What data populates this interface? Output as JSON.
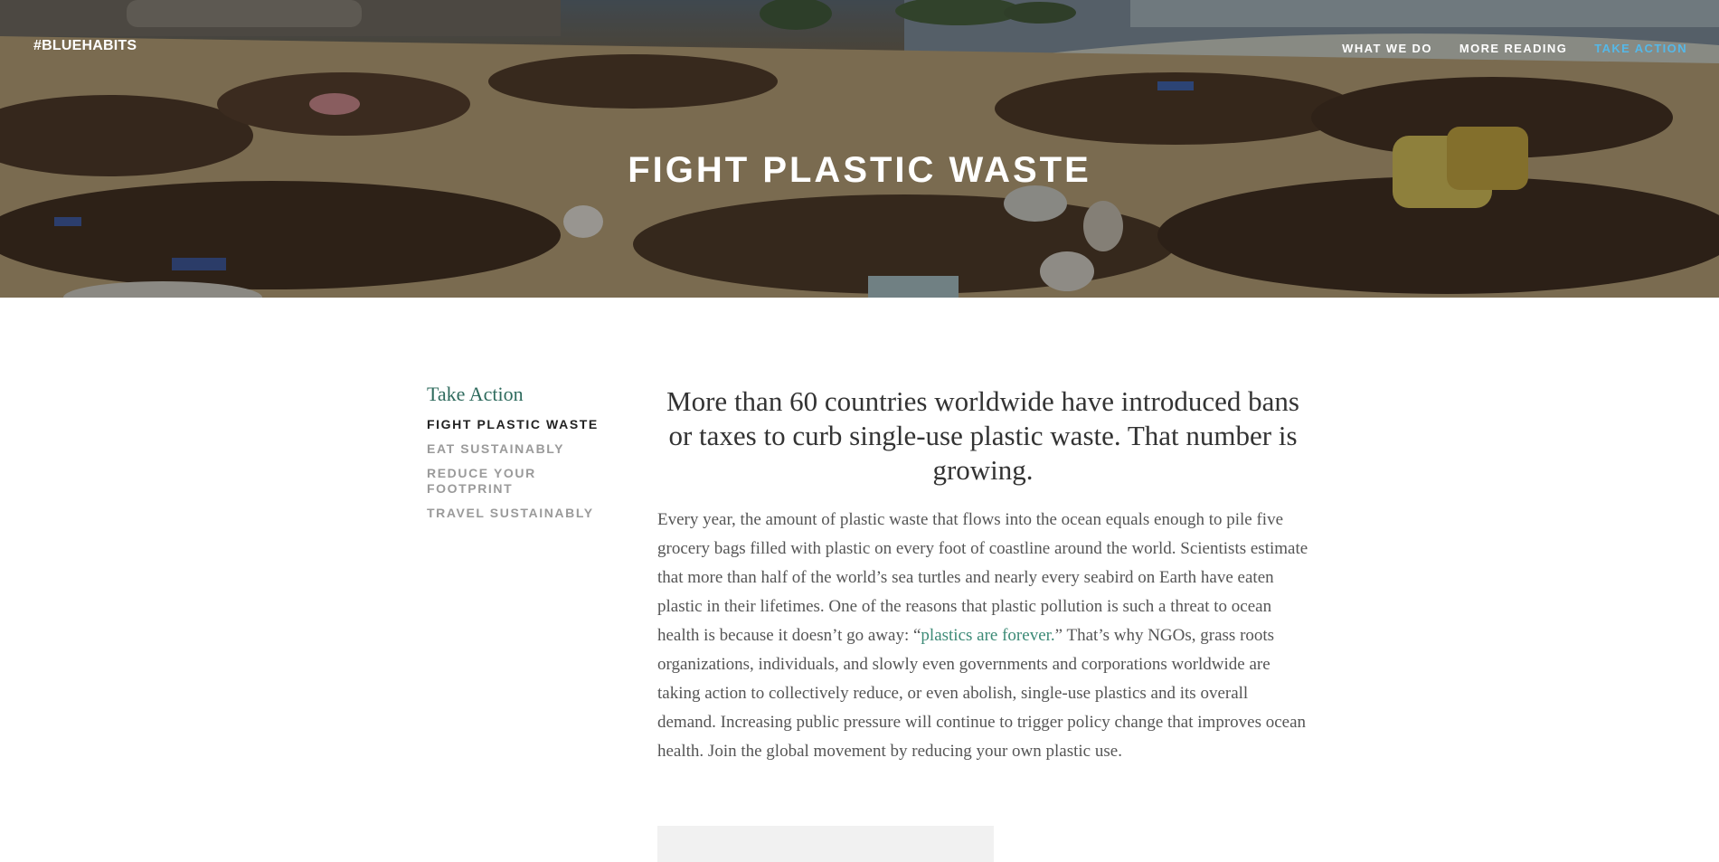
{
  "header": {
    "brand": "#BLUEHABITS",
    "nav": [
      {
        "label": "WHAT WE DO",
        "active": false
      },
      {
        "label": "MORE READING",
        "active": false
      },
      {
        "label": "TAKE ACTION",
        "active": true
      }
    ],
    "hero_title": "FIGHT PLASTIC WASTE"
  },
  "sidebar": {
    "heading": "Take Action",
    "items": [
      {
        "label": "FIGHT PLASTIC WASTE",
        "current": true
      },
      {
        "label": "EAT SUSTAINABLY",
        "current": false
      },
      {
        "label": "REDUCE YOUR FOOTPRINT",
        "current": false
      },
      {
        "label": "TRAVEL SUSTAINABLY",
        "current": false
      }
    ]
  },
  "article": {
    "lead": "More than 60 countries worldwide have introduced bans or taxes to curb single-use plastic waste. That number is growing.",
    "body_before_link": "Every year, the amount of plastic waste that flows into the ocean equals enough to pile five grocery bags filled with plastic on every foot of coastline around the world. Scientists estimate that more than half of the world’s sea turtles and nearly every seabird on Earth have eaten plastic in their lifetimes. One of the reasons that plastic pollution is such a threat to ocean health is because it doesn’t go away: “",
    "link_text": "plastics are forever.",
    "body_after_link": "”  That’s why NGOs, grass roots organizations, individuals, and slowly even governments and corporations worldwide are taking action to collectively reduce, or even abolish, single-use plastics and its overall demand. Increasing public pressure will continue to trigger policy change that improves ocean health. Join the global movement by reducing your own plastic use."
  },
  "colors": {
    "accent_nav": "#55b8e8",
    "link": "#3c8a76",
    "sidebar_heading": "#2f6b5e"
  }
}
